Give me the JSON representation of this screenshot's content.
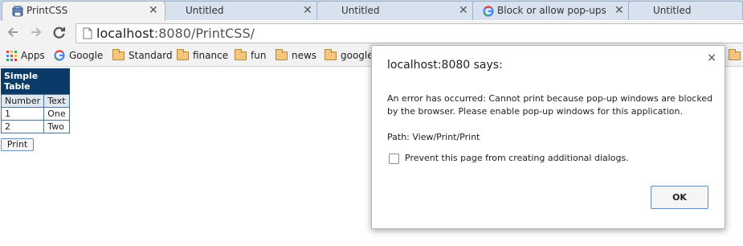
{
  "tabs": [
    {
      "title": "PrintCSS",
      "active": true,
      "favicon": "app-favicon-icon"
    },
    {
      "title": "Untitled",
      "active": false
    },
    {
      "title": "Untitled",
      "active": false
    },
    {
      "title": "Block or allow pop-ups in",
      "active": false,
      "favicon": "google-g-icon"
    },
    {
      "title": "Untitled",
      "active": false
    }
  ],
  "toolbar": {
    "back_icon": "back-arrow-icon",
    "forward_icon": "forward-arrow-icon",
    "reload_icon": "reload-icon",
    "url_host": "localhost",
    "url_rest": ":8080/PrintCSS/"
  },
  "bookmarks": [
    {
      "label": "Apps",
      "icon": "apps-grid-icon"
    },
    {
      "label": "Google",
      "icon": "google-g-icon"
    },
    {
      "label": "Standard",
      "icon": "folder-icon"
    },
    {
      "label": "finance",
      "icon": "folder-icon"
    },
    {
      "label": "fun",
      "icon": "folder-icon"
    },
    {
      "label": "news",
      "icon": "folder-icon"
    },
    {
      "label": "google",
      "icon": "folder-icon"
    }
  ],
  "page": {
    "table": {
      "caption": "Simple Table",
      "headers": [
        "Number",
        "Text"
      ],
      "rows": [
        [
          "1",
          "One"
        ],
        [
          "2",
          "Two"
        ]
      ]
    },
    "print_button": "Print"
  },
  "dialog": {
    "title": "localhost:8080 says:",
    "close": "×",
    "message": "An error has occurred: Cannot print because pop-up windows are blocked by the browser. Please enable pop-up windows for this application.",
    "path": "Path: View/Print/Print",
    "checkbox_label": "Prevent this page from creating additional dialogs.",
    "ok_label": "OK"
  },
  "colors": {
    "tabstrip": "#c7d4e5",
    "table_caption": "#0a3a68",
    "button_border": "#5a8fd0"
  }
}
